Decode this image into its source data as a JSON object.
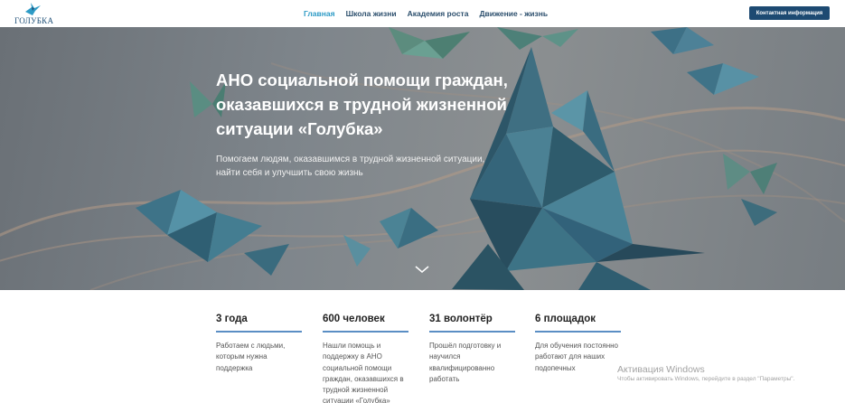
{
  "header": {
    "logo_text": "ГОЛУБКА",
    "nav": [
      {
        "label": "Главная",
        "active": true
      },
      {
        "label": "Школа жизни",
        "active": false
      },
      {
        "label": "Академия роста",
        "active": false
      },
      {
        "label": "Движение - жизнь",
        "active": false
      }
    ],
    "contact_button": "Контактная информация"
  },
  "hero": {
    "title": "АНО социальной помощи граждан, оказавшихся в трудной жизненной ситуации «Голубка»",
    "subtitle": "Помогаем людям, оказавшимся в трудной жизненной ситуации, найти себя и улучшить свою жизнь",
    "scroll_icon": "chevron-down-icon"
  },
  "stats": [
    {
      "value": "3 года",
      "description": "Работаем с людьми, которым нужна поддержка"
    },
    {
      "value": "600 человек",
      "description": "Нашли помощь и поддержку в АНО социальной помощи граждан, оказавшихся в трудной жизненной ситуации «Голубка»"
    },
    {
      "value": "31 волонтёр",
      "description": "Прошёл подготовку и научился квалифицированно работать"
    },
    {
      "value": "6 площадок",
      "description": "Для обучения постоянно работают для наших подопечных"
    }
  ],
  "watermark": {
    "title": "Активация Windows",
    "subtitle": "Чтобы активировать Windows, перейдите в раздел \"Параметры\"."
  },
  "colors": {
    "accent": "#2e9bc6",
    "brand": "#1d4a72",
    "stat_line": "#5a8ec4"
  }
}
